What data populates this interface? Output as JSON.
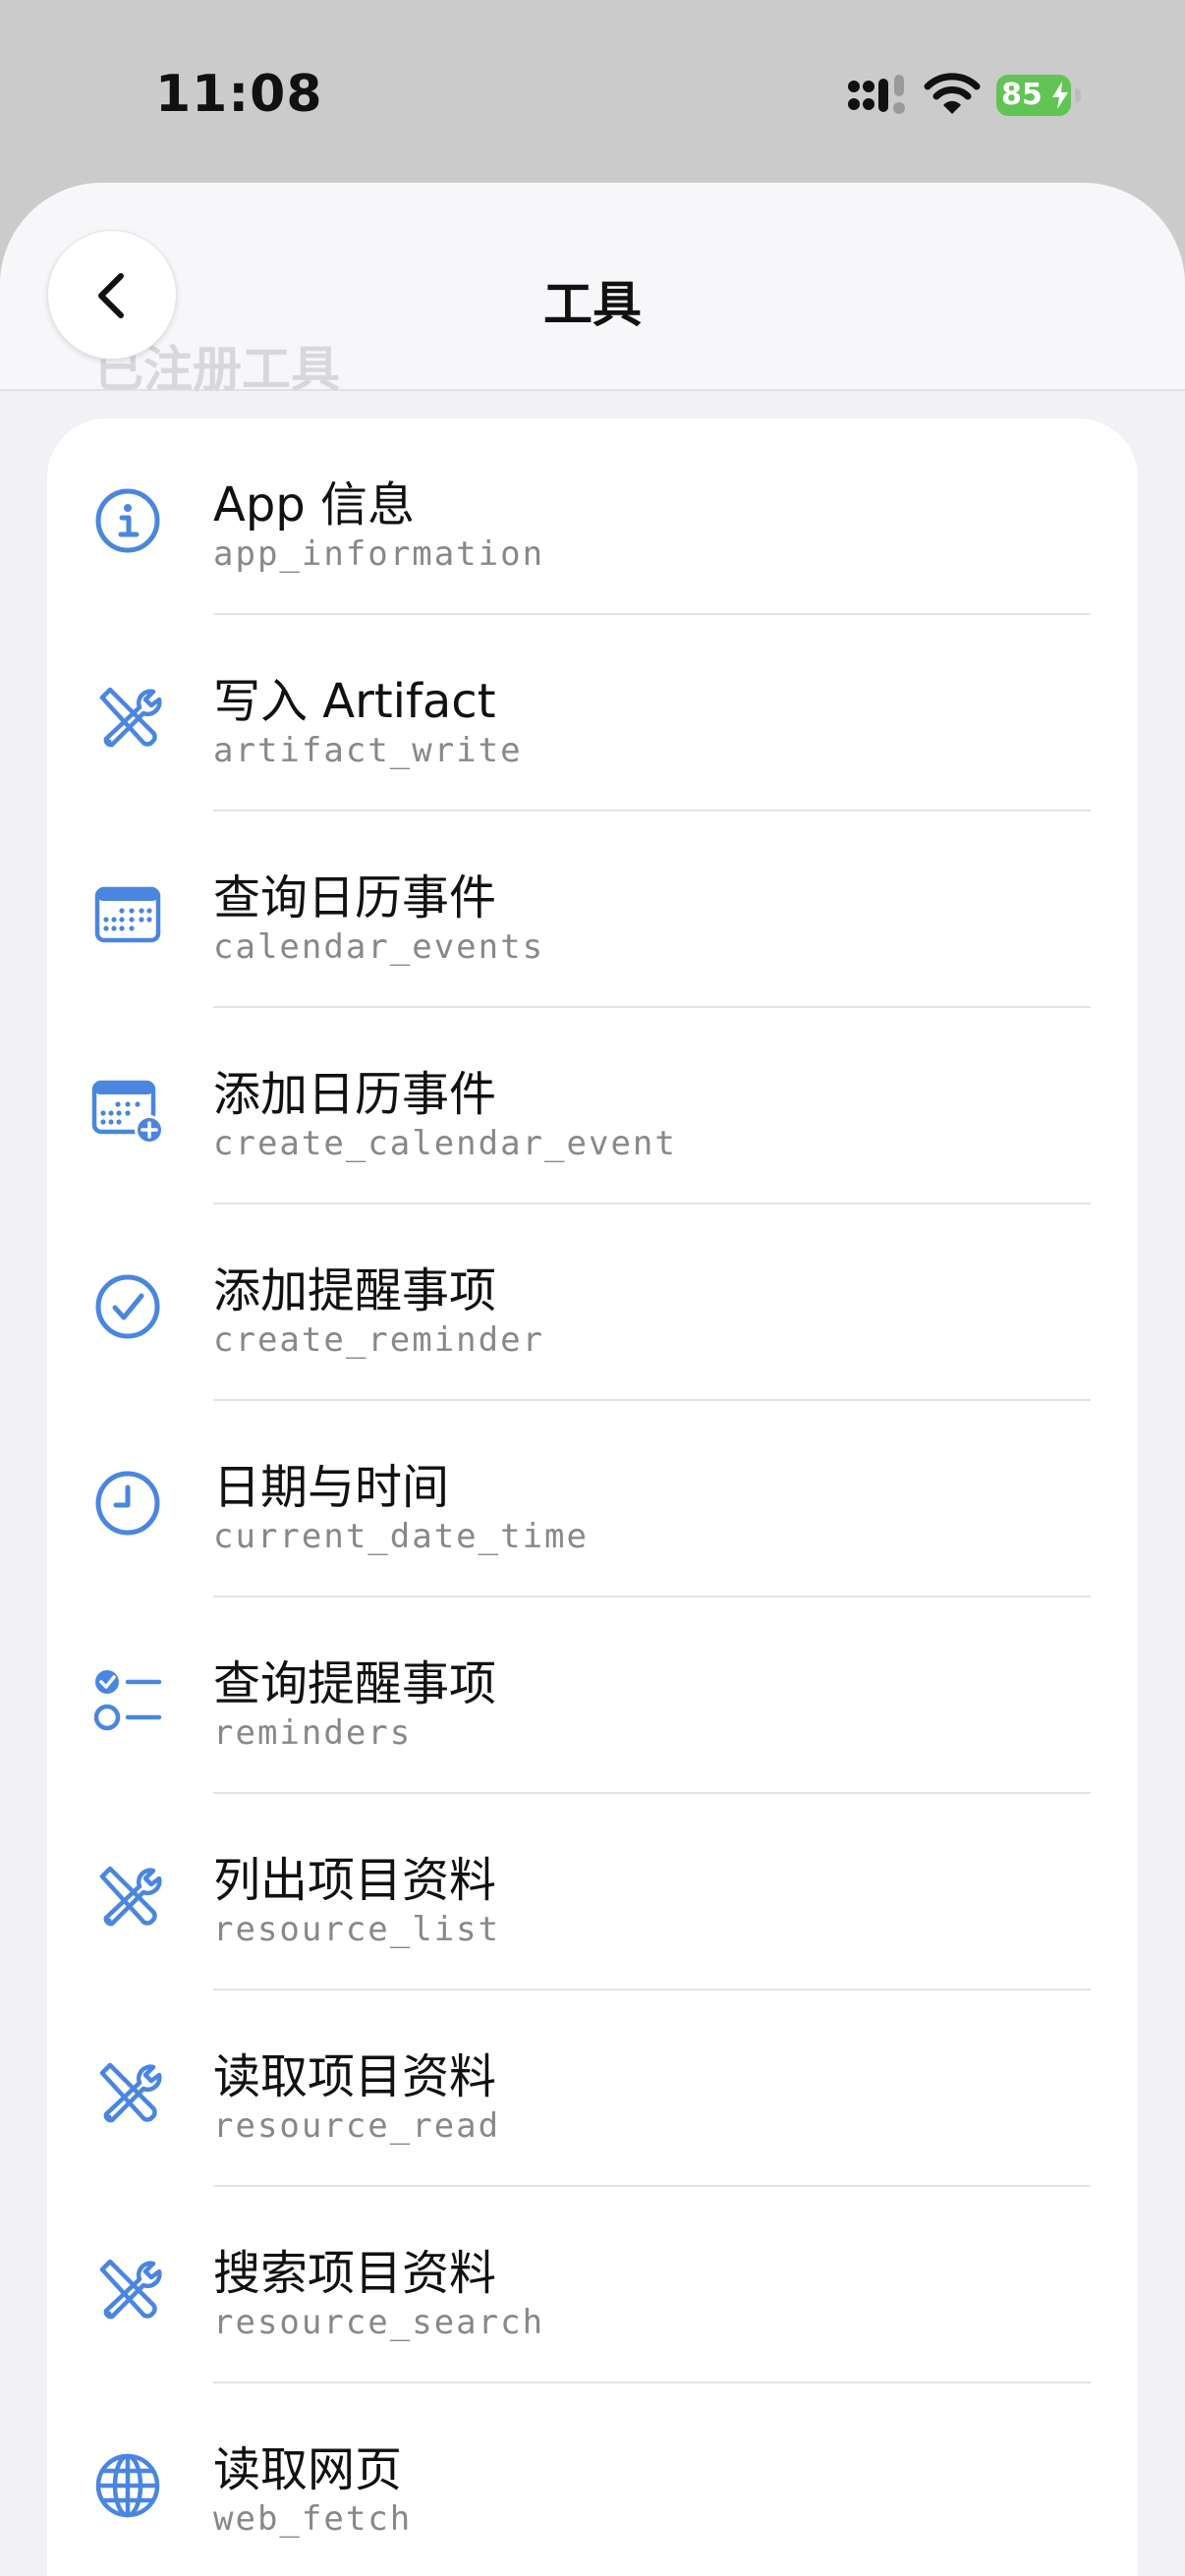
{
  "status_bar": {
    "time": "11:08",
    "battery": "85"
  },
  "header": {
    "title": "工具",
    "ghost_title": "已注册工具"
  },
  "colors": {
    "accent": "#4a86e0",
    "battery": "#62c454"
  },
  "tools": [
    {
      "title": "App 信息",
      "id": "app_information",
      "icon": "info-icon"
    },
    {
      "title": "写入 Artifact",
      "id": "artifact_write",
      "icon": "tools-icon"
    },
    {
      "title": "查询日历事件",
      "id": "calendar_events",
      "icon": "calendar-icon"
    },
    {
      "title": "添加日历事件",
      "id": "create_calendar_event",
      "icon": "calendar-add-icon"
    },
    {
      "title": "添加提醒事项",
      "id": "create_reminder",
      "icon": "checkmark-circle-icon"
    },
    {
      "title": "日期与时间",
      "id": "current_date_time",
      "icon": "clock-icon"
    },
    {
      "title": "查询提醒事项",
      "id": "reminders",
      "icon": "checklist-icon"
    },
    {
      "title": "列出项目资料",
      "id": "resource_list",
      "icon": "tools-icon"
    },
    {
      "title": "读取项目资料",
      "id": "resource_read",
      "icon": "tools-icon"
    },
    {
      "title": "搜索项目资料",
      "id": "resource_search",
      "icon": "tools-icon"
    },
    {
      "title": "读取网页",
      "id": "web_fetch",
      "icon": "globe-icon"
    }
  ]
}
